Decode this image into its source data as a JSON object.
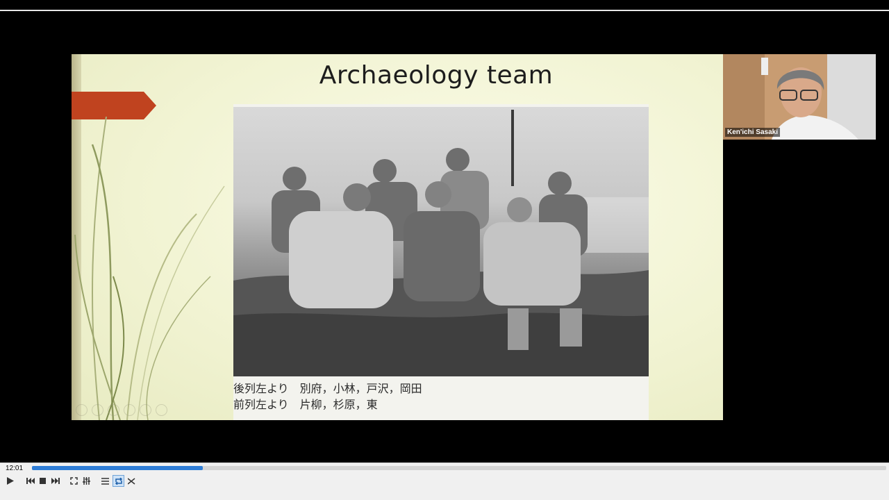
{
  "slide": {
    "title": "Archaeology team",
    "caption_line1": "後列左より　別府，小林，戸沢，岡田",
    "caption_line2": "前列左より　片柳，杉原，東"
  },
  "webcam": {
    "participant_name": "Ken'ichi Sasaki"
  },
  "player": {
    "current_time": "12:01",
    "progress_fraction": 0.2,
    "accent_color": "#2e7dd6",
    "buttons": [
      "play-icon",
      "previous-icon",
      "stop-icon",
      "next-icon",
      "fullscreen-icon",
      "equalizer-icon",
      "playlist-icon",
      "loop-icon",
      "shuffle-icon"
    ]
  },
  "colors": {
    "slide_arrow": "#c0431f",
    "slide_background": "#f3f5dc"
  }
}
